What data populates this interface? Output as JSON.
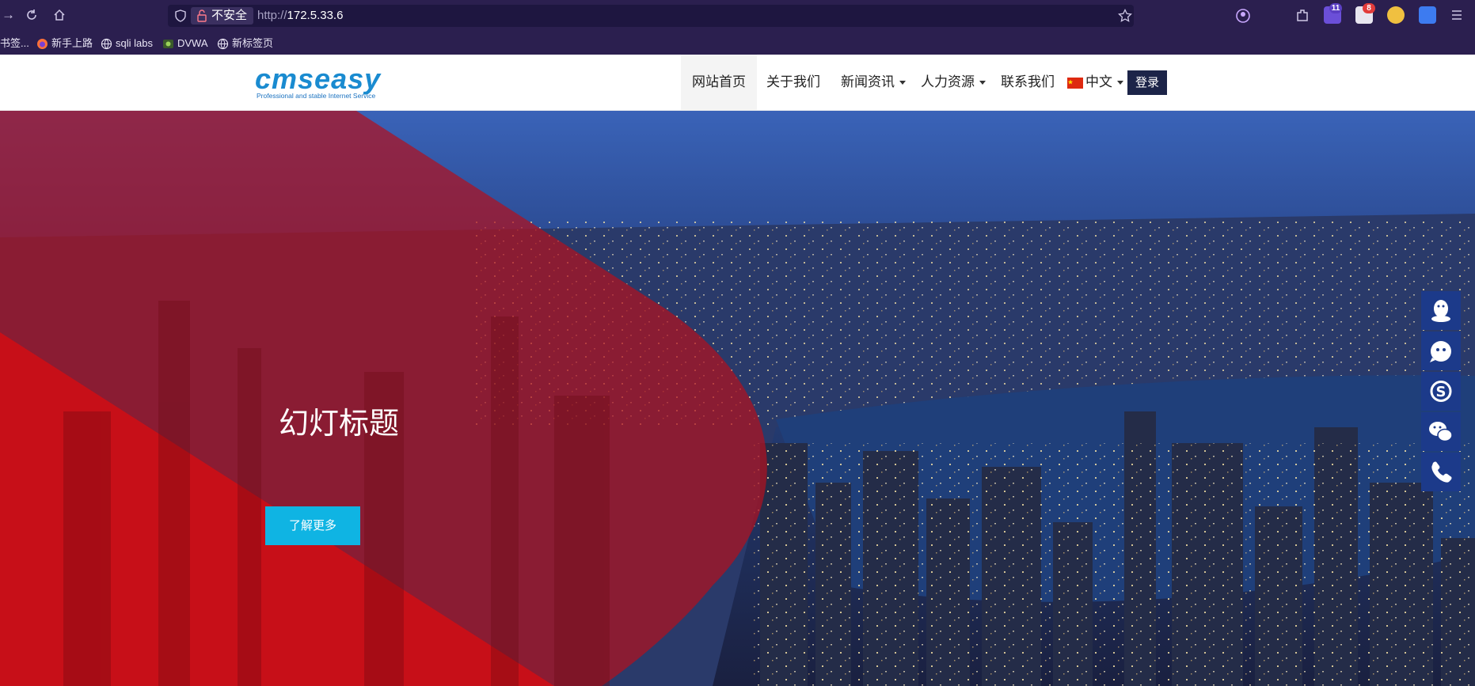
{
  "browser": {
    "nav_icons": [
      "forward-icon",
      "reload-icon",
      "home-icon"
    ],
    "security_label": "不安全",
    "url_prefix": "http://",
    "url_host": "172.5.33.6",
    "ext_badges": {
      "ext1": "11",
      "ext2": "8"
    }
  },
  "bookmarks": [
    {
      "label": "书签..."
    },
    {
      "label": "新手上路"
    },
    {
      "label": "sqli labs"
    },
    {
      "label": "DVWA"
    },
    {
      "label": "新标签页"
    }
  ],
  "site": {
    "logo_text": "cmseasy",
    "logo_tagline": "Professional and stable Internet Service",
    "nav": [
      {
        "label": "网站首页"
      },
      {
        "label": "关于我们"
      },
      {
        "label": "新闻资讯"
      },
      {
        "label": "人力资源"
      },
      {
        "label": "联系我们"
      },
      {
        "label": "中文"
      }
    ],
    "login": "登录",
    "hero_title": "幻灯标题",
    "hero_button": "了解更多",
    "side_tools": [
      "qq-icon",
      "chat-bubble-icon",
      "skype-icon",
      "wechat-icon",
      "phone-icon"
    ]
  },
  "colors": {
    "browser_bg": "#2b1f4f",
    "hero_red": "#d10d14",
    "hero_button": "#0fb4e3",
    "login_bg": "#1c2448",
    "side_tools_bg": "#1c3a8a"
  }
}
